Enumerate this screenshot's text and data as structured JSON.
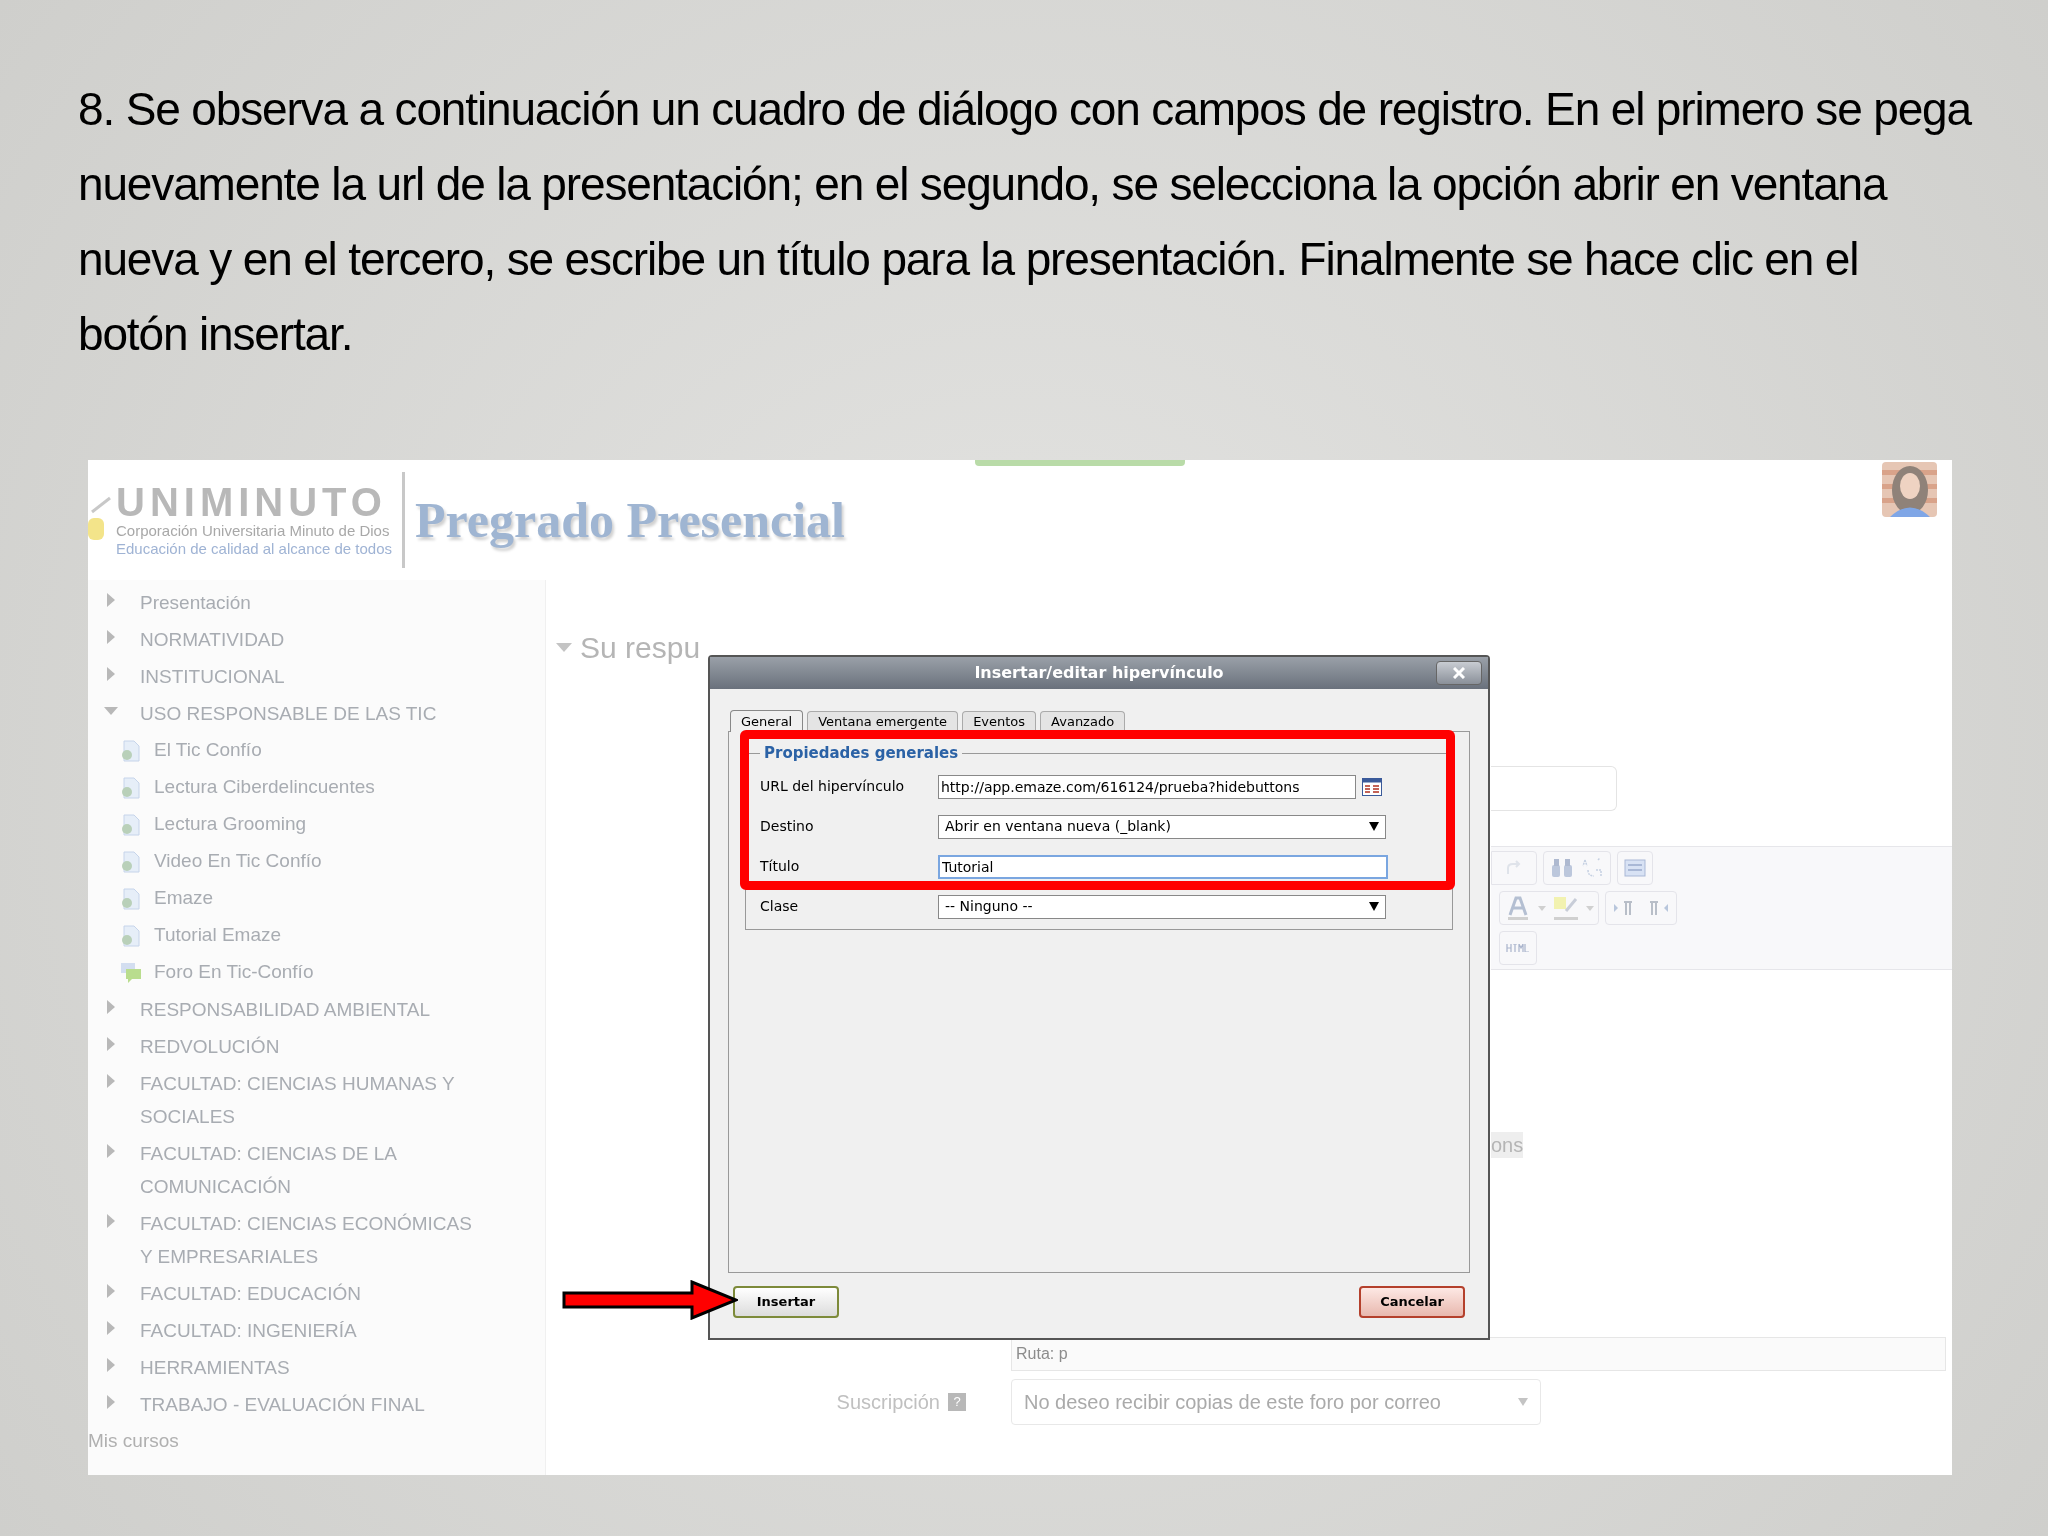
{
  "caption": "8. Se observa a continuación un cuadro de diálogo con campos de registro. En el primero se pega nuevamente la url de la presentación; en el segundo, se selecciona la opción abrir en ventana nueva y en el tercero, se escribe un título para la presentación. Finalmente se hace clic en el botón insertar.",
  "header": {
    "logo_name": "UNIMINUTO",
    "logo_line1": "Corporación Universitaria Minuto de Dios",
    "logo_line2": "Educación de calidad al alcance de todos",
    "site_title": "Pregrado Presencial"
  },
  "sidebar": {
    "items": [
      {
        "label": "Presentación",
        "expanded": false
      },
      {
        "label": "NORMATIVIDAD",
        "expanded": false
      },
      {
        "label": "INSTITUCIONAL",
        "expanded": false
      },
      {
        "label": "USO RESPONSABLE DE LAS TIC",
        "expanded": true,
        "children": [
          {
            "label": "El Tic Confío",
            "kind": "page"
          },
          {
            "label": "Lectura Ciberdelincuentes",
            "kind": "page"
          },
          {
            "label": "Lectura Grooming",
            "kind": "page"
          },
          {
            "label": "Video En Tic Confío",
            "kind": "page"
          },
          {
            "label": "Emaze",
            "kind": "page"
          },
          {
            "label": "Tutorial Emaze",
            "kind": "page"
          },
          {
            "label": "Foro En Tic-Confío",
            "kind": "forum"
          }
        ]
      },
      {
        "label": "RESPONSABILIDAD AMBIENTAL",
        "expanded": false
      },
      {
        "label": "REDVOLUCIÓN",
        "expanded": false
      },
      {
        "label": "FACULTAD: CIENCIAS HUMANAS Y SOCIALES",
        "expanded": false
      },
      {
        "label": "FACULTAD: CIENCIAS DE LA COMUNICACIÓN",
        "expanded": false
      },
      {
        "label": "FACULTAD: CIENCIAS ECONÓMICAS Y EMPRESARIALES",
        "expanded": false
      },
      {
        "label": "FACULTAD: EDUCACIÓN",
        "expanded": false
      },
      {
        "label": "FACULTAD: INGENIERÍA",
        "expanded": false
      },
      {
        "label": "HERRAMIENTAS",
        "expanded": false
      },
      {
        "label": "TRABAJO - EVALUACIÓN FINAL",
        "expanded": false
      }
    ],
    "footer_link": "Mis cursos"
  },
  "main": {
    "section_heading": "Su respu",
    "fragment": "ons",
    "path": "Ruta: p",
    "subscription": {
      "label": "Suscripción",
      "help": "?",
      "value": "No deseo recibir copias de este foro por correo"
    }
  },
  "dialog": {
    "title": "Insertar/editar hipervínculo",
    "tabs": [
      {
        "label": "General",
        "selected": true
      },
      {
        "label": "Ventana emergente",
        "selected": false
      },
      {
        "label": "Eventos",
        "selected": false
      },
      {
        "label": "Avanzado",
        "selected": false
      }
    ],
    "legend": "Propiedades generales",
    "fields": [
      {
        "label": "URL del hipervínculo",
        "kind": "text",
        "value": "http://app.emaze.com/616124/prueba?hidebuttons",
        "focused": false,
        "browse": true
      },
      {
        "label": "Destino",
        "kind": "select",
        "value": "Abrir en ventana nueva (_blank)"
      },
      {
        "label": "Título",
        "kind": "text",
        "value": "Tutorial",
        "focused": true
      },
      {
        "label": "Clase",
        "kind": "select",
        "value": "-- Ninguno --"
      }
    ],
    "buttons": [
      {
        "label": "Insertar",
        "kind": "insert"
      },
      {
        "label": "Cancelar",
        "kind": "cancel"
      }
    ]
  }
}
